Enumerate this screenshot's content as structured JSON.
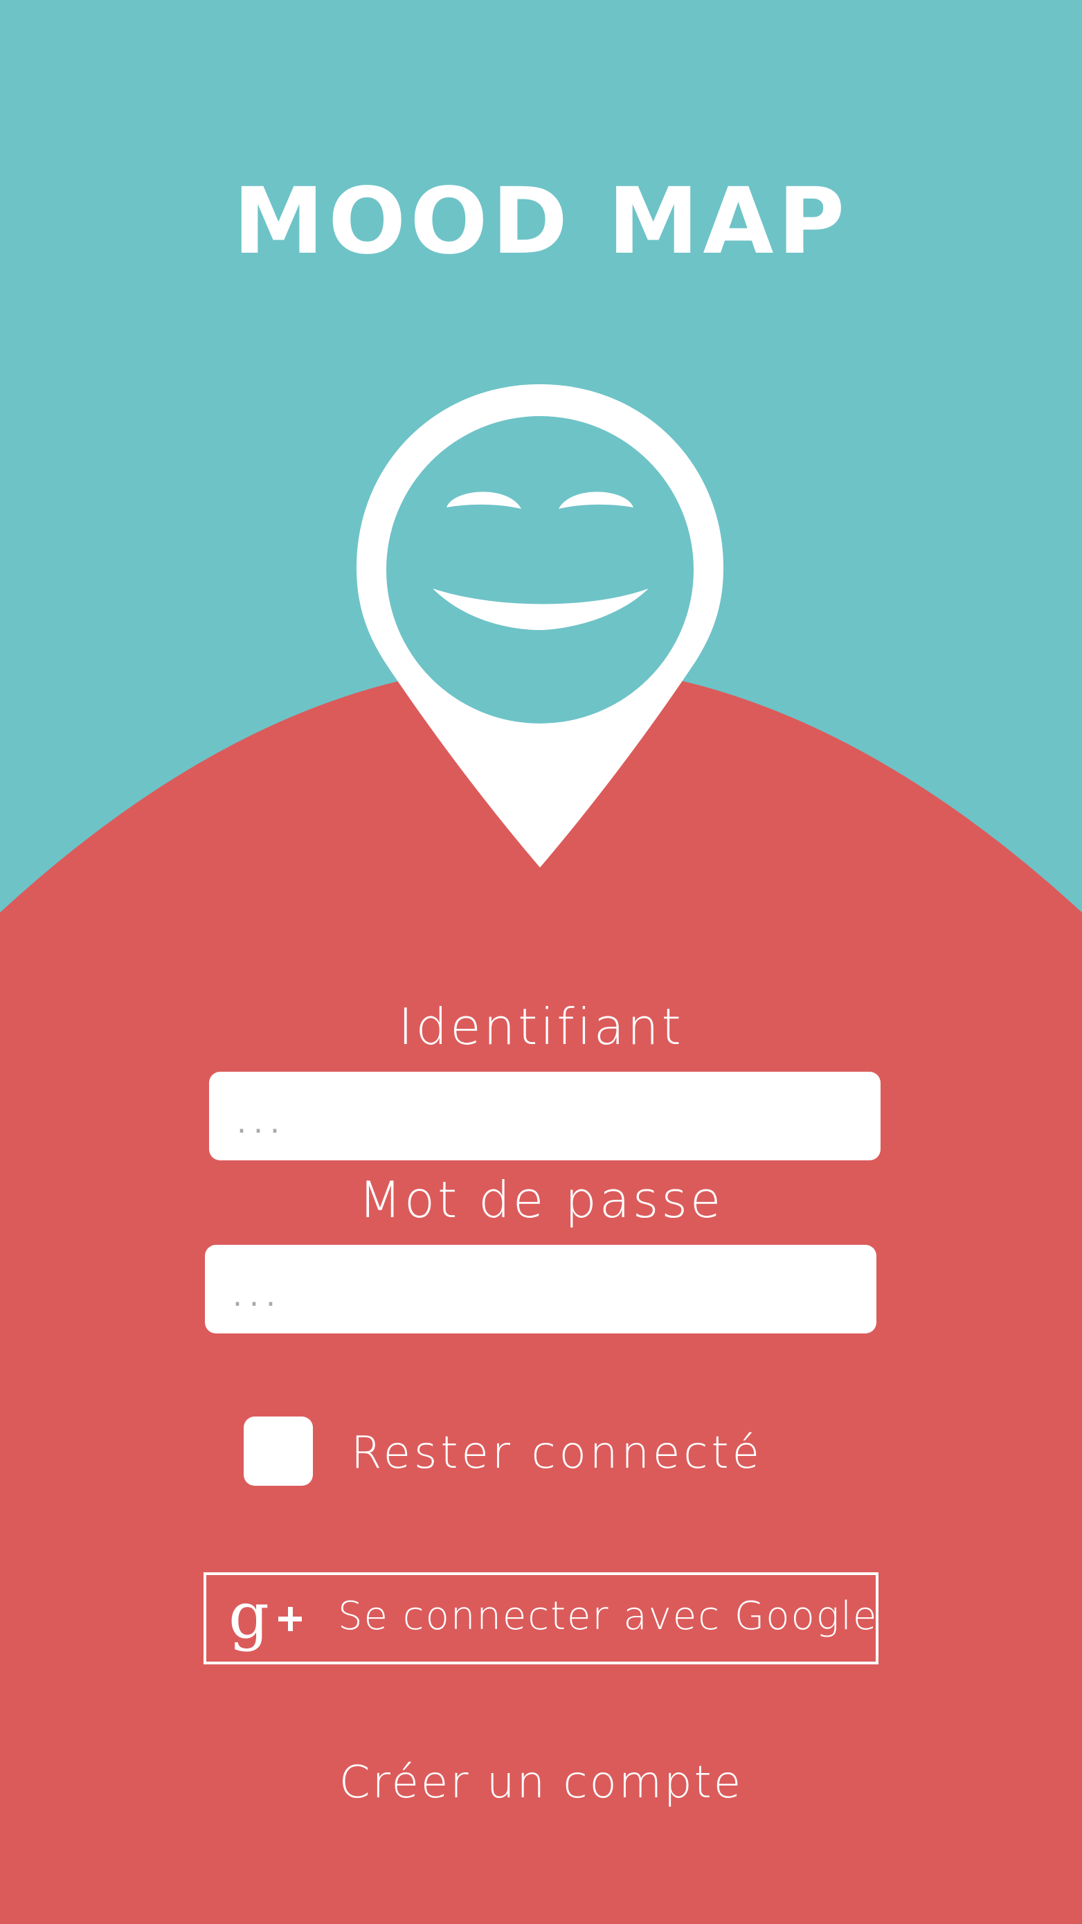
{
  "app": {
    "title": "MOOD MAP"
  },
  "colors": {
    "top_background": "#6ec3c7",
    "bottom_background": "#db5b5b",
    "foreground": "#ffffff"
  },
  "logo": {
    "icon": "smiling-map-pin-icon"
  },
  "login": {
    "identifier_label": "Identifiant",
    "identifier_placeholder": "...",
    "password_label": "Mot de passe",
    "password_placeholder": "...",
    "remember_label": "Rester connecté",
    "remember_checked": false,
    "google_icon": "google-plus-icon",
    "google_label": "Se connecter avec Google",
    "create_account_label": "Créer un compte"
  }
}
